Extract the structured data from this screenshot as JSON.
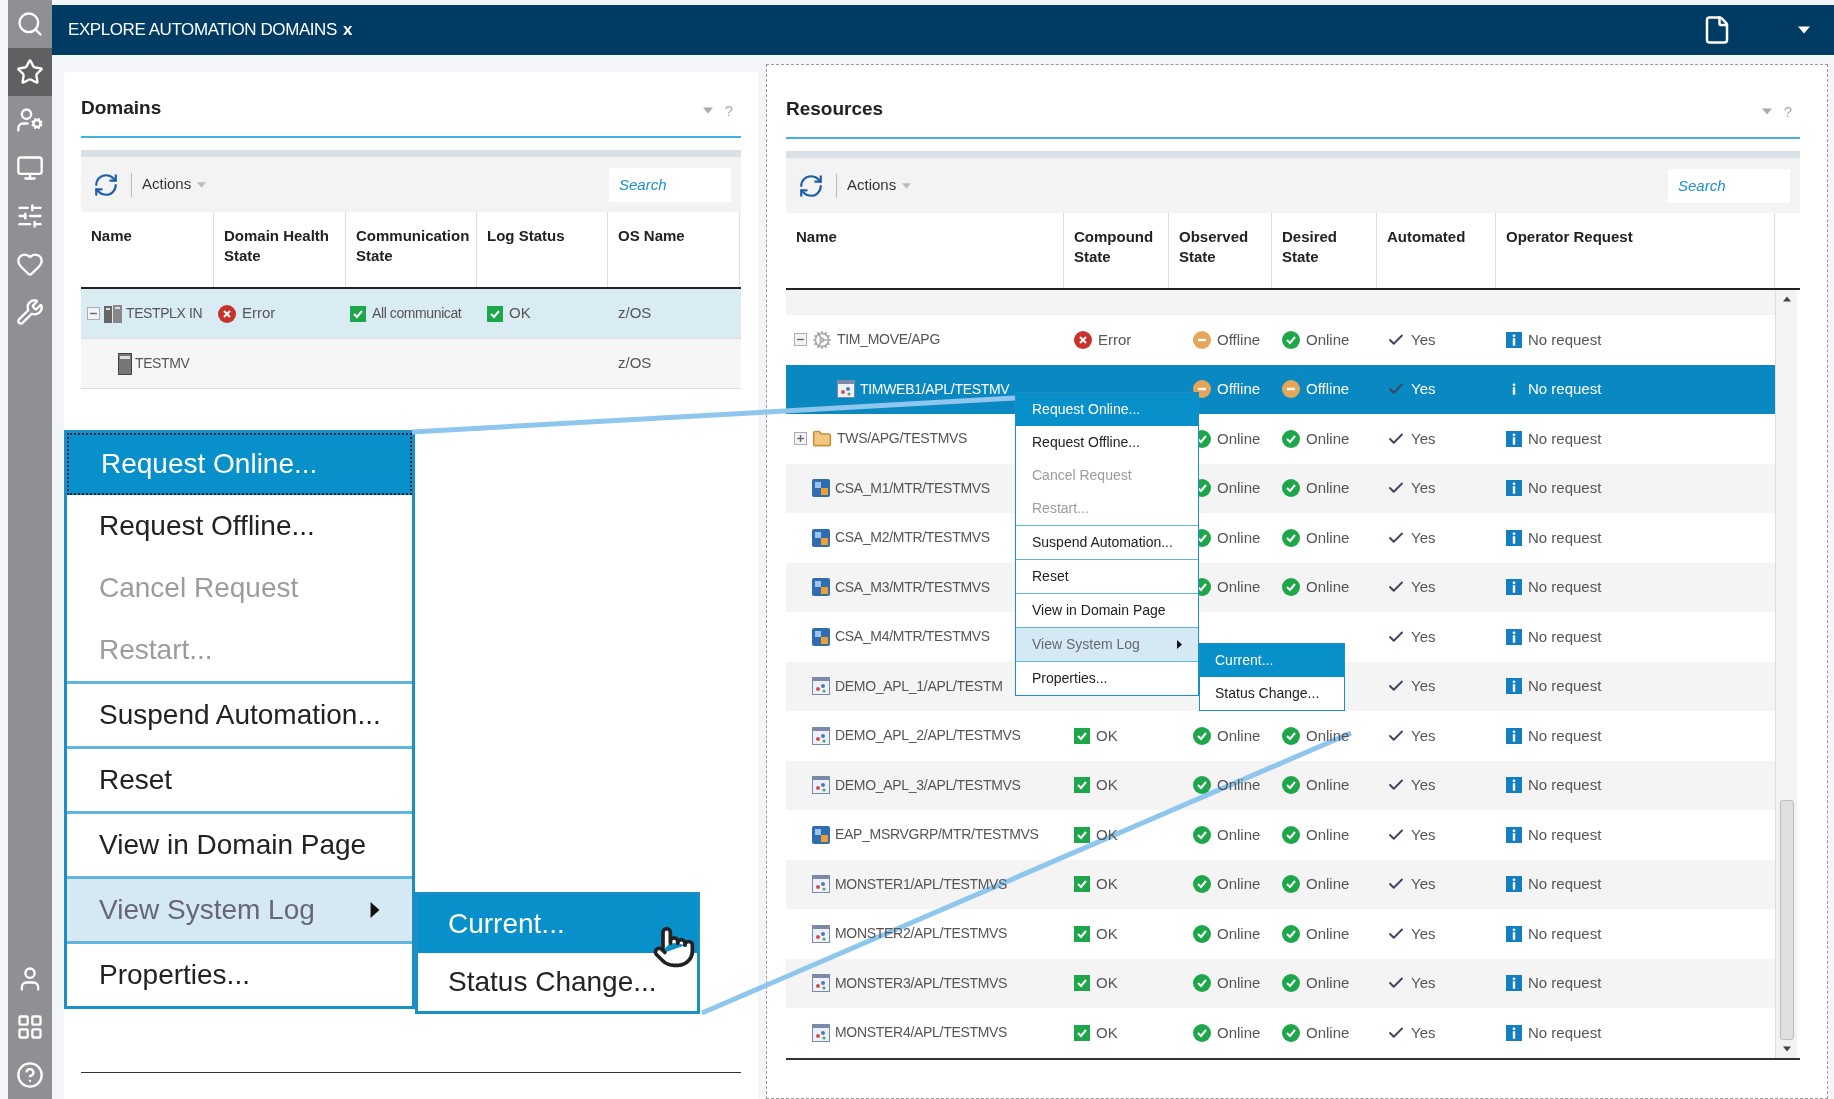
{
  "sidebar": {
    "top": [
      {
        "kind": "search",
        "selected": false
      },
      {
        "kind": "star",
        "selected": true
      },
      {
        "kind": "user-chart",
        "selected": false
      },
      {
        "kind": "monitor",
        "selected": false
      },
      {
        "kind": "sliders",
        "selected": false
      },
      {
        "kind": "heart",
        "selected": false
      },
      {
        "kind": "tools",
        "selected": false
      }
    ],
    "bottom": [
      {
        "kind": "user",
        "selected": false
      },
      {
        "kind": "grid",
        "selected": false
      },
      {
        "kind": "help",
        "selected": false
      }
    ]
  },
  "header": {
    "title": "EXPLORE AUTOMATION DOMAINS",
    "close": "x"
  },
  "domains": {
    "title": "Domains",
    "help": "?",
    "actions": "Actions",
    "search": {
      "placeholder": "Search"
    },
    "columns": [
      "Name",
      "Domain Health State",
      "Communication State",
      "Log Status",
      "OS Name"
    ],
    "rows": [
      {
        "name": "TESTPLX IN",
        "kind": "sysplex",
        "expanded": true,
        "selected": true,
        "health": {
          "kind": "error",
          "text": "Error"
        },
        "communication": {
          "kind": "ok",
          "text": "All communicat"
        },
        "log": {
          "kind": "ok",
          "text": "OK"
        },
        "os": "z/OS",
        "children": [
          {
            "name": "TESTMV",
            "kind": "system",
            "selected": false,
            "os": "z/OS"
          }
        ]
      }
    ]
  },
  "resources": {
    "title": "Resources",
    "help": "?",
    "actions": "Actions",
    "search": {
      "placeholder": "Search"
    },
    "columns": [
      "Name",
      "Compound State",
      "Observed State",
      "Desired State",
      "Automated",
      "Operator Request"
    ],
    "rows": [
      {
        "name": "TIM_MOVE/APG",
        "kind": "move",
        "expanded": true,
        "selected": false,
        "compound": {
          "kind": "error",
          "text": "Error"
        },
        "observed": {
          "kind": "offline",
          "text": "Offline"
        },
        "desired": {
          "kind": "online",
          "text": "Online"
        },
        "automated": "Yes",
        "request": "No request",
        "children": [
          {
            "name": "TIMWEB1/APL/TESTMV",
            "kind": "app",
            "selected": true,
            "observed": {
              "kind": "offline",
              "text": "Offline"
            },
            "desired": {
              "kind": "offline",
              "text": "Offline"
            },
            "automated": "Yes",
            "request": "No request"
          }
        ]
      },
      {
        "name": "TWS/APG/TESTMVS",
        "kind": "group",
        "expanded": false,
        "selected": false,
        "observed": {
          "kind": "online",
          "text": "Online"
        },
        "desired": {
          "kind": "online",
          "text": "Online"
        },
        "automated": "Yes",
        "request": "No request"
      },
      {
        "name": "CSA_M1/MTR/TESTMVS",
        "kind": "mtr",
        "selected": false,
        "observed": {
          "kind": "online",
          "text": "Online"
        },
        "desired": {
          "kind": "online",
          "text": "Online"
        },
        "automated": "Yes",
        "request": "No request"
      },
      {
        "name": "CSA_M2/MTR/TESTMVS",
        "kind": "mtr",
        "selected": false,
        "observed": {
          "kind": "online",
          "text": "Online"
        },
        "desired": {
          "kind": "online",
          "text": "Online"
        },
        "automated": "Yes",
        "request": "No request"
      },
      {
        "name": "CSA_M3/MTR/TESTMVS",
        "kind": "mtr",
        "selected": false,
        "observed": {
          "kind": "online",
          "text": "Online"
        },
        "desired": {
          "kind": "online",
          "text": "Online"
        },
        "automated": "Yes",
        "request": "No request"
      },
      {
        "name": "CSA_M4/MTR/TESTMVS",
        "kind": "mtr",
        "selected": false,
        "automated": "Yes",
        "request": "No request"
      },
      {
        "name": "DEMO_APL_1/APL/TESTM",
        "kind": "app",
        "selected": false,
        "automated": "Yes",
        "request": "No request"
      },
      {
        "name": "DEMO_APL_2/APL/TESTMVS",
        "kind": "app",
        "selected": false,
        "compound": {
          "kind": "ok",
          "text": "OK"
        },
        "observed": {
          "kind": "online",
          "text": "Online"
        },
        "desired": {
          "kind": "online",
          "text": "Online"
        },
        "automated": "Yes",
        "request": "No request"
      },
      {
        "name": "DEMO_APL_3/APL/TESTMVS",
        "kind": "app",
        "selected": false,
        "compound": {
          "kind": "ok",
          "text": "OK"
        },
        "observed": {
          "kind": "online",
          "text": "Online"
        },
        "desired": {
          "kind": "online",
          "text": "Online"
        },
        "automated": "Yes",
        "request": "No request"
      },
      {
        "name": "EAP_MSRVGRP/MTR/TESTMVS",
        "kind": "mtr",
        "selected": false,
        "compound": {
          "kind": "ok",
          "text": "OK"
        },
        "observed": {
          "kind": "online",
          "text": "Online"
        },
        "desired": {
          "kind": "online",
          "text": "Online"
        },
        "automated": "Yes",
        "request": "No request"
      },
      {
        "name": "MONSTER1/APL/TESTMVS",
        "kind": "app",
        "selected": false,
        "compound": {
          "kind": "ok",
          "text": "OK"
        },
        "observed": {
          "kind": "online",
          "text": "Online"
        },
        "desired": {
          "kind": "online",
          "text": "Online"
        },
        "automated": "Yes",
        "request": "No request"
      },
      {
        "name": "MONSTER2/APL/TESTMVS",
        "kind": "app",
        "selected": false,
        "compound": {
          "kind": "ok",
          "text": "OK"
        },
        "observed": {
          "kind": "online",
          "text": "Online"
        },
        "desired": {
          "kind": "online",
          "text": "Online"
        },
        "automated": "Yes",
        "request": "No request"
      },
      {
        "name": "MONSTER3/APL/TESTMVS",
        "kind": "app",
        "selected": false,
        "compound": {
          "kind": "ok",
          "text": "OK"
        },
        "observed": {
          "kind": "online",
          "text": "Online"
        },
        "desired": {
          "kind": "online",
          "text": "Online"
        },
        "automated": "Yes",
        "request": "No request"
      },
      {
        "name": "MONSTER4/APL/TESTMVS",
        "kind": "app",
        "selected": false,
        "compound": {
          "kind": "ok",
          "text": "OK"
        },
        "observed": {
          "kind": "online",
          "text": "Online"
        },
        "desired": {
          "kind": "online",
          "text": "Online"
        },
        "automated": "Yes",
        "request": "No request"
      }
    ]
  },
  "context_menu": {
    "groups": [
      [
        {
          "label": "Request Online...",
          "selected": true,
          "disabled": false,
          "open": false,
          "submenu": false
        },
        {
          "label": "Request Offline...",
          "selected": false,
          "disabled": false,
          "open": false,
          "submenu": false
        },
        {
          "label": "Cancel Request",
          "selected": false,
          "disabled": true,
          "open": false,
          "submenu": false
        },
        {
          "label": "Restart...",
          "selected": false,
          "disabled": true,
          "open": false,
          "submenu": false
        }
      ],
      [
        {
          "label": "Suspend Automation...",
          "selected": false,
          "disabled": false,
          "open": false,
          "submenu": false
        }
      ],
      [
        {
          "label": "Reset",
          "selected": false,
          "disabled": false,
          "open": false,
          "submenu": false
        }
      ],
      [
        {
          "label": "View in Domain Page",
          "selected": false,
          "disabled": false,
          "open": false,
          "submenu": false
        }
      ],
      [
        {
          "label": "View System Log",
          "selected": false,
          "disabled": false,
          "open": true,
          "submenu": true
        }
      ],
      [
        {
          "label": "Properties...",
          "selected": false,
          "disabled": false,
          "open": false,
          "submenu": false
        }
      ]
    ],
    "submenu": [
      {
        "label": "Current...",
        "selected": true
      },
      {
        "label": "Status Change...",
        "selected": false
      }
    ]
  },
  "magnified_menu": {
    "groups": [
      [
        {
          "label": "Request Online...",
          "selected": true,
          "disabled": false,
          "open": false,
          "submenu": false
        },
        {
          "label": "Request Offline...",
          "selected": false,
          "disabled": false,
          "open": false,
          "submenu": false
        },
        {
          "label": "Cancel Request",
          "selected": false,
          "disabled": true,
          "open": false,
          "submenu": false
        },
        {
          "label": "Restart...",
          "selected": false,
          "disabled": true,
          "open": false,
          "submenu": false
        }
      ],
      [
        {
          "label": "Suspend Automation...",
          "selected": false,
          "disabled": false,
          "open": false,
          "submenu": false
        }
      ],
      [
        {
          "label": "Reset",
          "selected": false,
          "disabled": false,
          "open": false,
          "submenu": false
        }
      ],
      [
        {
          "label": "View in Domain Page",
          "selected": false,
          "disabled": false,
          "open": false,
          "submenu": false
        }
      ],
      [
        {
          "label": "View System Log",
          "selected": false,
          "disabled": false,
          "open": true,
          "submenu": true
        }
      ],
      [
        {
          "label": "Properties...",
          "selected": false,
          "disabled": false,
          "open": false,
          "submenu": false
        }
      ]
    ],
    "submenu": [
      {
        "label": "Current...",
        "selected": true
      },
      {
        "label": "Status Change...",
        "selected": false
      }
    ]
  }
}
